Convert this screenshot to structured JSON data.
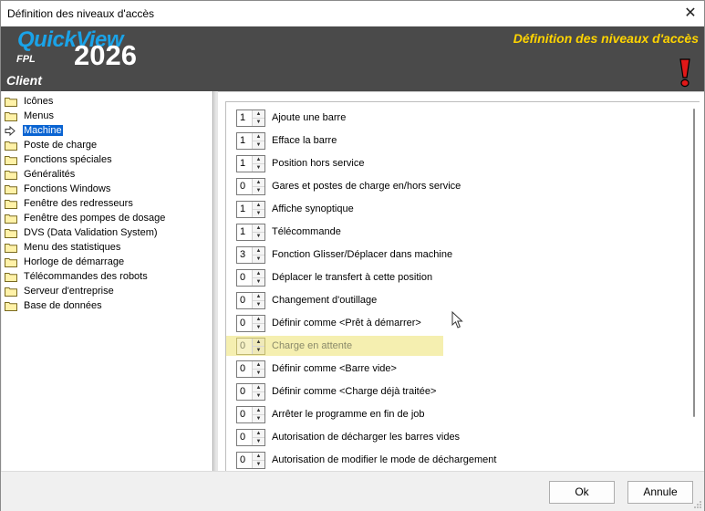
{
  "window": {
    "title": "Définition des niveaux d'accès",
    "close_glyph": "✕"
  },
  "header": {
    "brand_name": "QuickView",
    "brand_sub": "FPL",
    "brand_year": "2026",
    "profile": "Client",
    "title": "Définition des niveaux d'accès",
    "accent_color": "#ffd400",
    "brand_color": "#1aa3e8"
  },
  "tree": {
    "items": [
      {
        "label": "Icônes",
        "icon": "folder-icon"
      },
      {
        "label": "Menus",
        "icon": "folder-icon"
      },
      {
        "label": "Machine",
        "icon": "arrow-right-icon",
        "selected": true
      },
      {
        "label": "Poste de charge",
        "icon": "folder-icon"
      },
      {
        "label": "Fonctions spéciales",
        "icon": "folder-icon"
      },
      {
        "label": "Généralités",
        "icon": "folder-icon"
      },
      {
        "label": "Fonctions Windows",
        "icon": "folder-icon"
      },
      {
        "label": "Fenêtre des redresseurs",
        "icon": "folder-icon"
      },
      {
        "label": "Fenêtre des pompes de dosage",
        "icon": "folder-icon"
      },
      {
        "label": "DVS (Data Validation System)",
        "icon": "folder-icon"
      },
      {
        "label": "Menu des statistiques",
        "icon": "folder-icon"
      },
      {
        "label": "Horloge de démarrage",
        "icon": "folder-icon"
      },
      {
        "label": "Télécommandes des robots",
        "icon": "folder-icon"
      },
      {
        "label": "Serveur d'entreprise",
        "icon": "folder-icon"
      },
      {
        "label": "Base de données",
        "icon": "folder-icon"
      }
    ]
  },
  "settings": {
    "rows": [
      {
        "value": "1",
        "label": "Ajoute une barre"
      },
      {
        "value": "1",
        "label": "Efface la barre"
      },
      {
        "value": "1",
        "label": "Position hors service"
      },
      {
        "value": "0",
        "label": "Gares et postes de charge en/hors service"
      },
      {
        "value": "1",
        "label": "Affiche synoptique"
      },
      {
        "value": "1",
        "label": "Télécommande"
      },
      {
        "value": "3",
        "label": "Fonction Glisser/Déplacer dans machine"
      },
      {
        "value": "0",
        "label": "Déplacer le transfert à cette position"
      },
      {
        "value": "0",
        "label": "Changement d'outillage"
      },
      {
        "value": "0",
        "label": "Définir comme <Prêt à démarrer>"
      },
      {
        "value": "0",
        "label": "Charge en attente",
        "highlighted": true
      },
      {
        "value": "0",
        "label": "Définir comme <Barre vide>"
      },
      {
        "value": "0",
        "label": "Définir comme <Charge déjà traitée>"
      },
      {
        "value": "0",
        "label": "Arrêter le programme en fin de job"
      },
      {
        "value": "0",
        "label": "Autorisation de décharger les barres vides"
      },
      {
        "value": "0",
        "label": "Autorisation de modifier le mode de déchargement"
      }
    ],
    "highlight_color": "#f5efb0"
  },
  "footer": {
    "ok_label": "Ok",
    "cancel_label": "Annule"
  }
}
